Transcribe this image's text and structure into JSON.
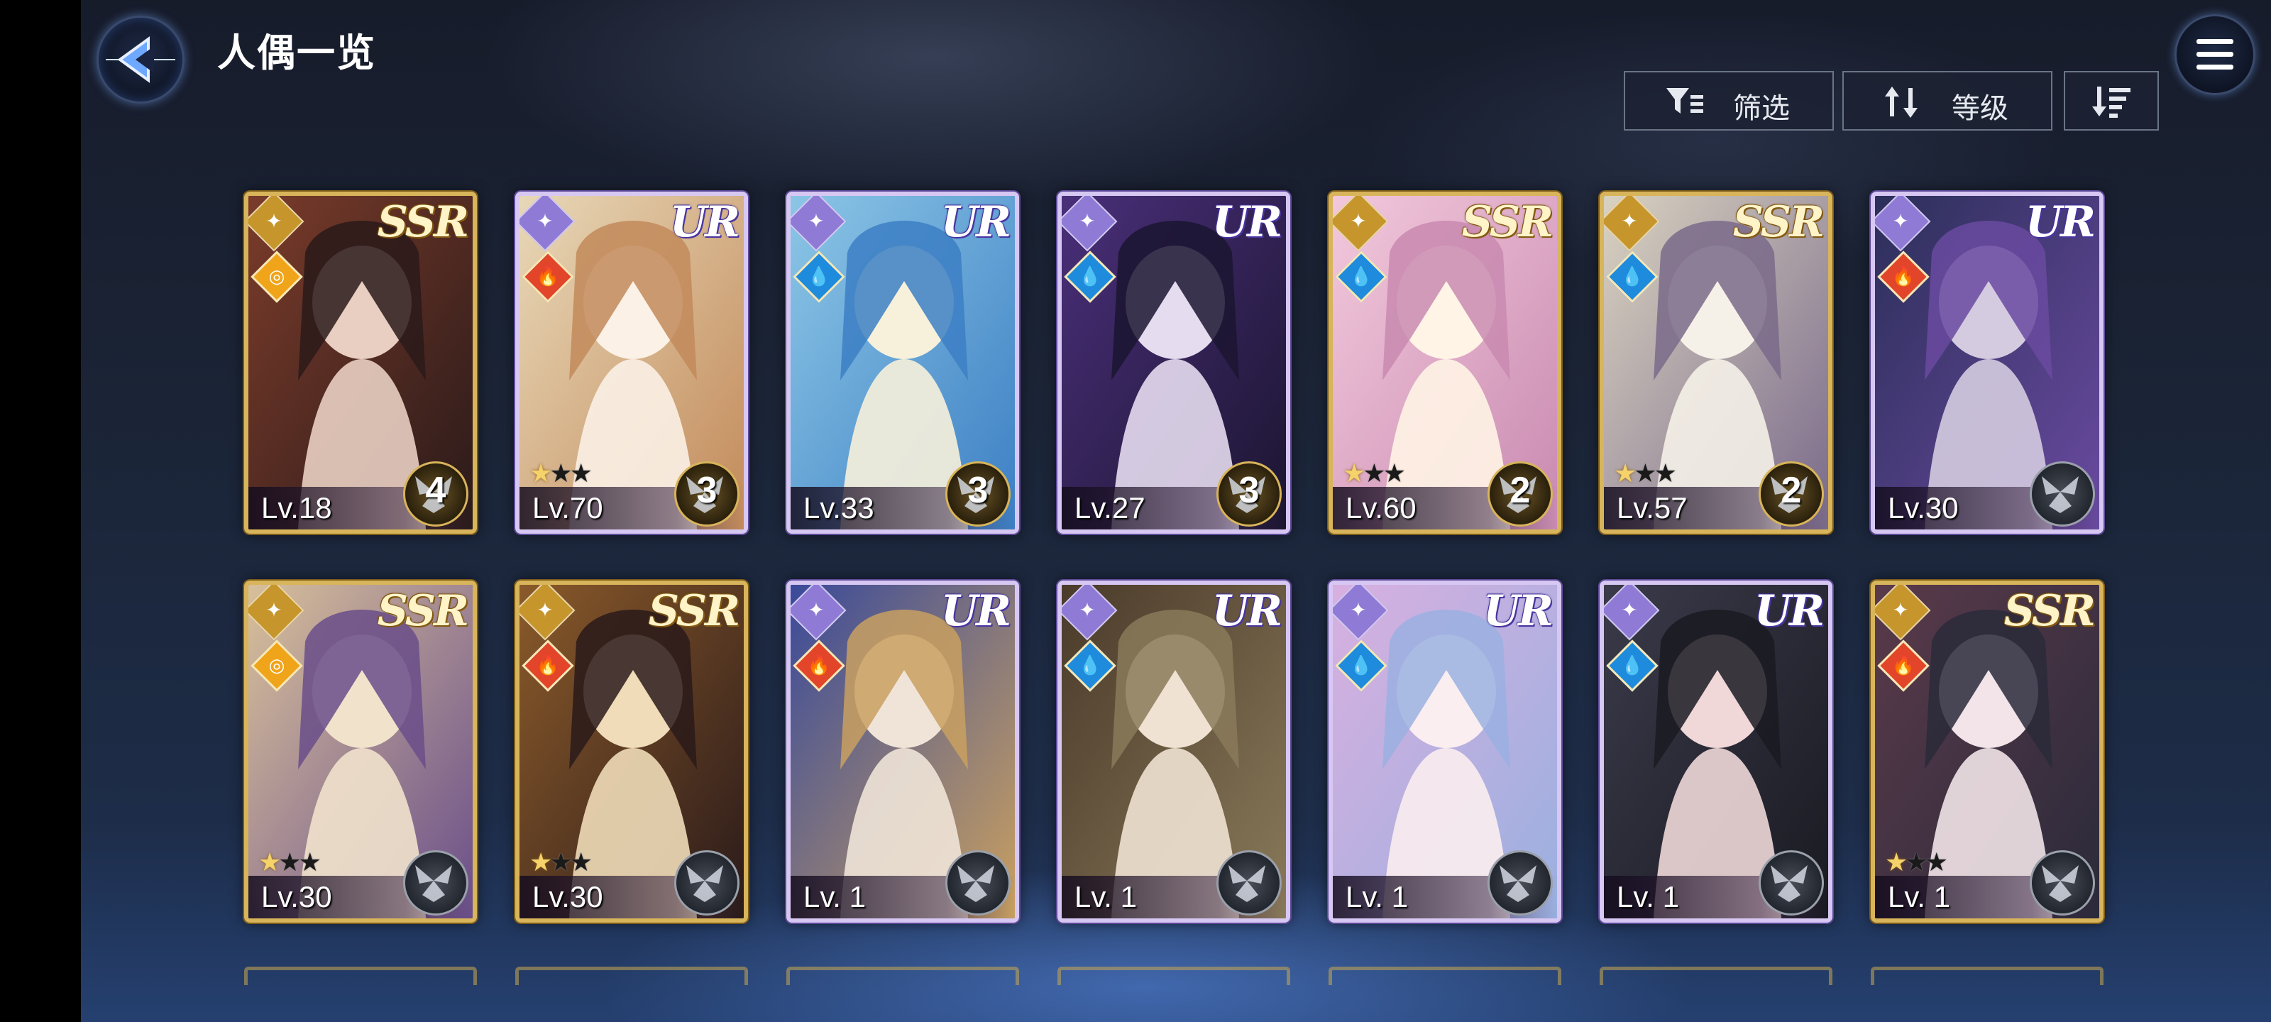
{
  "header": {
    "title": "人偶一览",
    "buttons": {
      "filter_label": "筛选",
      "sort_label": "等级"
    },
    "icons": {
      "back": "back-arrow-icon",
      "menu": "hamburger-menu-icon",
      "filter": "filter-icon",
      "sort": "sort-icon",
      "order": "sort-order-icon"
    }
  },
  "colors": {
    "ssr_frame": "#d8b45a",
    "ur_frame": "#d7c8f3",
    "fire": "#e2452a",
    "water": "#1f8bdc",
    "light": "#f0a41a"
  },
  "cards": [
    {
      "rarity": "SSR",
      "element": "light",
      "level": "Lv.18",
      "stars": 0,
      "awaken": "4"
    },
    {
      "rarity": "UR",
      "element": "fire",
      "level": "Lv.70",
      "stars": 3,
      "awaken": "3"
    },
    {
      "rarity": "UR",
      "element": "water",
      "level": "Lv.33",
      "stars": 0,
      "awaken": "3"
    },
    {
      "rarity": "UR",
      "element": "water",
      "level": "Lv.27",
      "stars": 0,
      "awaken": "3"
    },
    {
      "rarity": "SSR",
      "element": "water",
      "level": "Lv.60",
      "stars": 3,
      "awaken": "2"
    },
    {
      "rarity": "SSR",
      "element": "water",
      "level": "Lv.57",
      "stars": 3,
      "awaken": "2"
    },
    {
      "rarity": "UR",
      "element": "fire",
      "level": "Lv.30",
      "stars": 0,
      "awaken": ""
    },
    {
      "rarity": "SSR",
      "element": "light",
      "level": "Lv.30",
      "stars": 3,
      "awaken": ""
    },
    {
      "rarity": "SSR",
      "element": "fire",
      "level": "Lv.30",
      "stars": 3,
      "awaken": ""
    },
    {
      "rarity": "UR",
      "element": "fire",
      "level": "Lv. 1",
      "stars": 0,
      "awaken": ""
    },
    {
      "rarity": "UR",
      "element": "water",
      "level": "Lv. 1",
      "stars": 0,
      "awaken": ""
    },
    {
      "rarity": "UR",
      "element": "water",
      "level": "Lv. 1",
      "stars": 0,
      "awaken": ""
    },
    {
      "rarity": "UR",
      "element": "water",
      "level": "Lv. 1",
      "stars": 0,
      "awaken": ""
    },
    {
      "rarity": "SSR",
      "element": "fire",
      "level": "Lv. 1",
      "stars": 3,
      "awaken": ""
    }
  ]
}
